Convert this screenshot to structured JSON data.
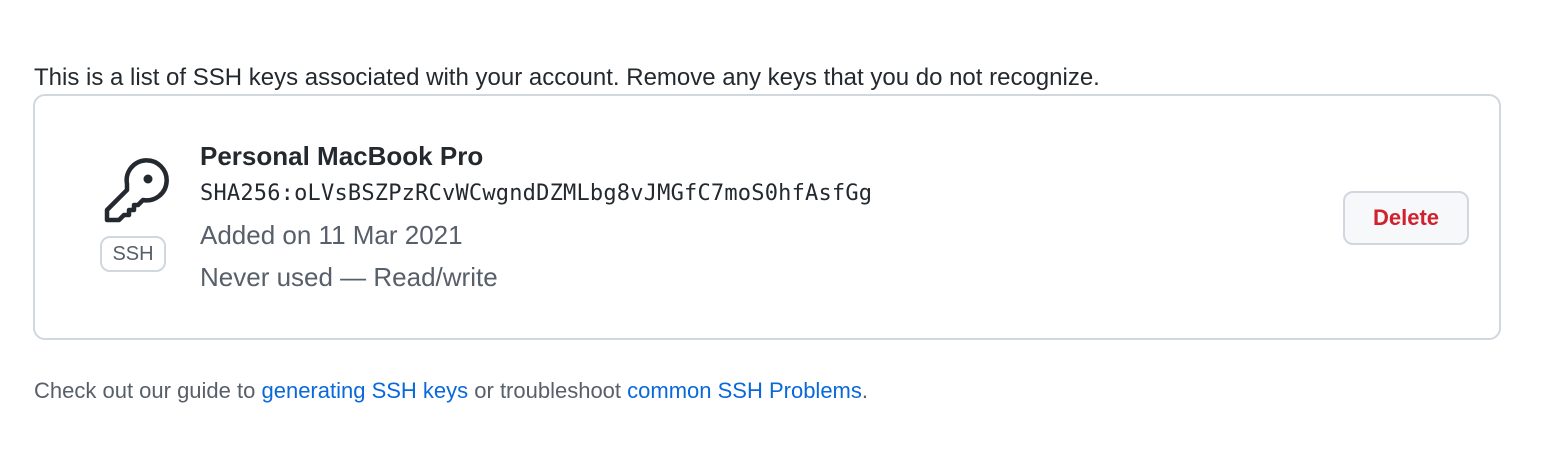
{
  "intro_text": "This is a list of SSH keys associated with your account. Remove any keys that you do not recognize.",
  "key": {
    "icon": "key-icon",
    "badge": "SSH",
    "title": "Personal MacBook Pro",
    "fingerprint": "SHA256:oLVsBSZPzRCvWCwgndDZMLbg8vJMGfC7moS0hfAsfGg",
    "added": "Added on 11 Mar 2021",
    "usage": "Never used — Read/write",
    "delete_label": "Delete"
  },
  "footer": {
    "prefix": "Check out our guide to ",
    "link1": "generating SSH keys",
    "middle": " or troubleshoot ",
    "link2": "common SSH Problems",
    "suffix": "."
  },
  "colors": {
    "text": "#24292f",
    "muted": "#57606a",
    "link": "#0969da",
    "danger": "#cf222e",
    "border": "#d0d7de"
  }
}
